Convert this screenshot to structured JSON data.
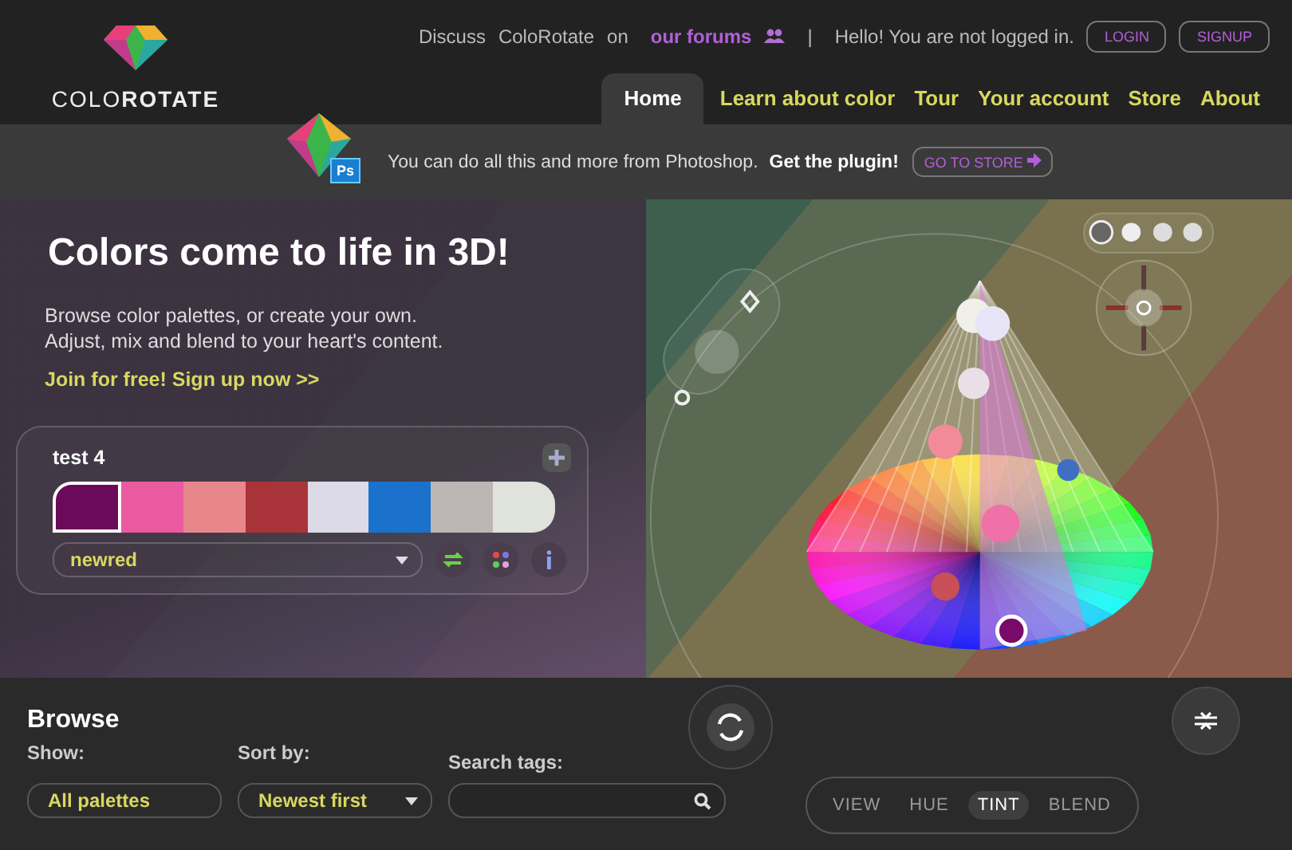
{
  "header": {
    "logo_text": "COLO**ROTATE**",
    "discuss": "Discuss",
    "site": "ColoRotate",
    "on": "on",
    "forums": "our forums",
    "separator": "|",
    "greeting": "Hello! You are not logged in.",
    "buttons": [
      "LOGIN",
      "SIGNUP"
    ]
  },
  "nav": [
    {
      "label": "Home",
      "selected": true
    },
    {
      "label": "Learn about color",
      "selected": false
    },
    {
      "label": "Tour",
      "selected": false
    },
    {
      "label": "Your account",
      "selected": false
    },
    {
      "label": "Store",
      "selected": false
    },
    {
      "label": "About",
      "selected": false
    }
  ],
  "promo": {
    "badge": "Ps",
    "text": "You can do all this and more from Photoshop.",
    "emphasis": "Get the plugin!",
    "button": "GO TO STORE"
  },
  "hero": {
    "title": "Colors come to life in 3D!",
    "lines": [
      "Browse color palettes, or create your own.",
      "Adjust, mix and blend to your heart's content."
    ],
    "link": "Join for free! Sign up now >>"
  },
  "palette": {
    "name": "test 4",
    "dropdown": "newred",
    "swatches": [
      {
        "color": "#6b0a5a",
        "selected": true
      },
      {
        "color": "#e95aa0",
        "selected": false
      },
      {
        "color": "#e8878b",
        "selected": false
      },
      {
        "color": "#a8343a",
        "selected": false
      },
      {
        "color": "#dcdae6",
        "selected": false
      },
      {
        "color": "#1a72cc",
        "selected": false
      },
      {
        "color": "#bcb6b4",
        "selected": false
      },
      {
        "color": "#e0e2dc",
        "selected": false
      }
    ]
  },
  "browse": {
    "title": "Browse",
    "filters": [
      {
        "kind": "select",
        "label": "Show:",
        "value": "All palettes"
      },
      {
        "kind": "dropdown",
        "label": "Sort by:",
        "value": "Newest first"
      },
      {
        "kind": "search",
        "label": "Search tags:"
      }
    ]
  },
  "modes": [
    {
      "label": "VIEW",
      "selected": false
    },
    {
      "label": "HUE",
      "selected": false
    },
    {
      "label": "TINT",
      "selected": true
    },
    {
      "label": "BLEND",
      "selected": false
    }
  ]
}
